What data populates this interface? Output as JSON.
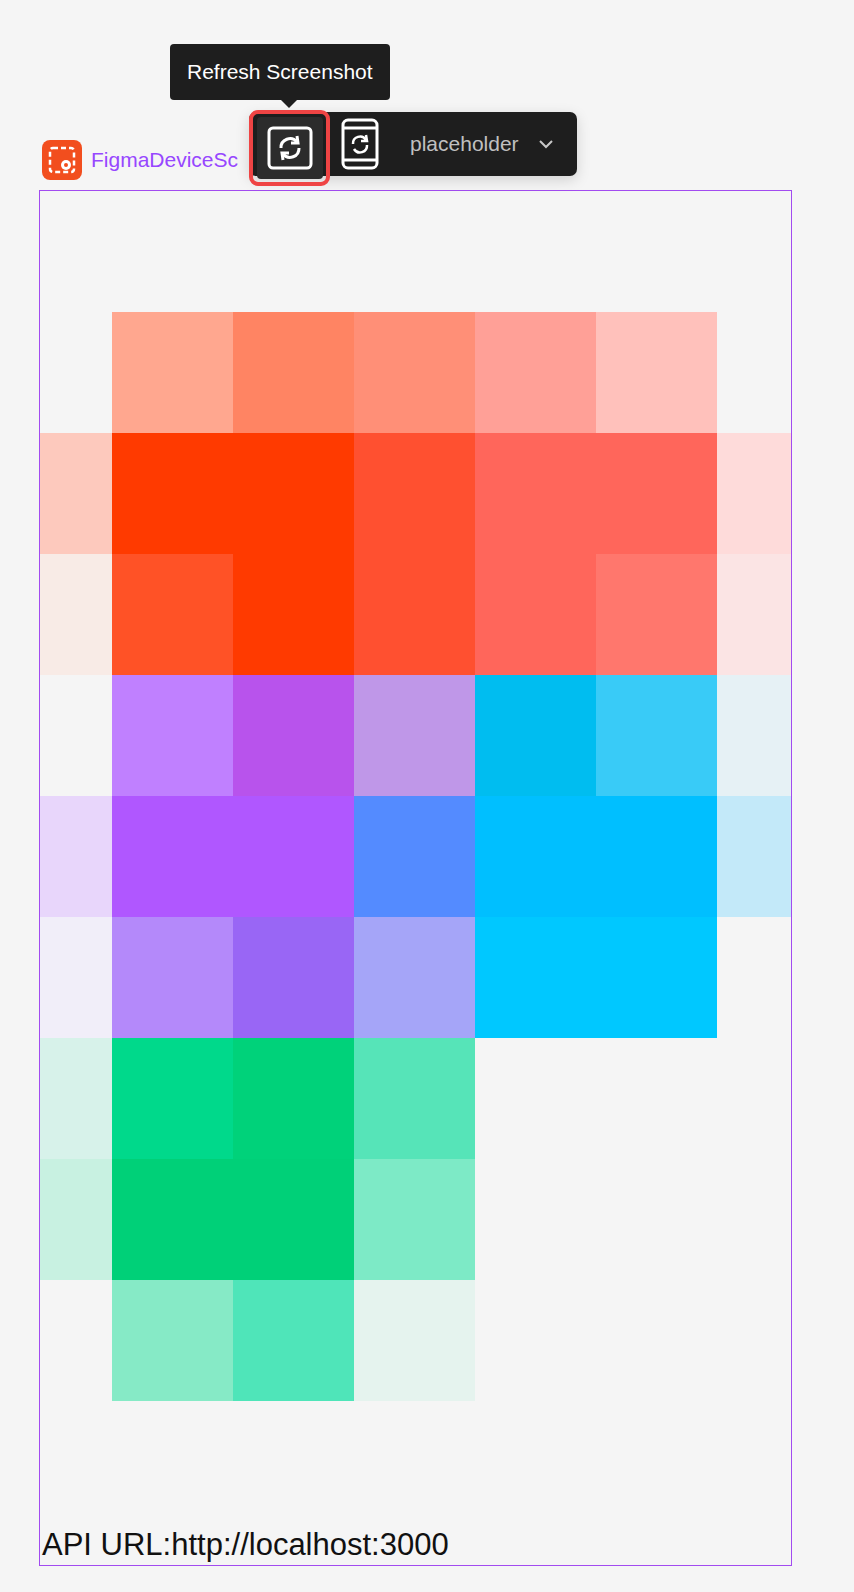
{
  "tooltip": {
    "text": "Refresh Screenshot"
  },
  "toolbar": {
    "buttons": [
      {
        "kind": "refresh",
        "highlighted": true
      },
      {
        "kind": "device",
        "highlighted": false
      }
    ],
    "dropdown": {
      "value": "placeholder"
    }
  },
  "frame": {
    "label": "FigmaDeviceSc",
    "pixels": [
      [
        null,
        "#ffa78f",
        "#ff8463",
        "#ff8f77",
        "#ffa097",
        "#ffc1bb",
        null
      ],
      [
        "#fdc9bd",
        "#ff3a00",
        "#ff3a00",
        "#ff5030",
        "#ff665b",
        "#ff665b",
        "#fedbda"
      ],
      [
        "#f8ebe6",
        "#ff5226",
        "#ff3a00",
        "#ff5030",
        "#ff665b",
        "#ff776d",
        "#fbe4e4"
      ],
      [
        null,
        "#c080ff",
        "#b853ec",
        "#bf97e8",
        "#00bdf0",
        "#39cbf7",
        "#e6f1f5"
      ],
      [
        "#e8d6fb",
        "#b057ff",
        "#b057ff",
        "#548bff",
        "#00bfff",
        "#00bfff",
        "#c3e9f9"
      ],
      [
        "#f1eef9",
        "#b489fa",
        "#9966f5",
        "#a5a5f8",
        "#00c8ff",
        "#00c8ff",
        null
      ],
      [
        "#d7f2ea",
        "#00d98b",
        "#00d27a",
        "#56e4b8",
        null,
        null,
        null
      ],
      [
        "#c8f1e1",
        "#00d078",
        "#00d078",
        "#7deac6",
        null,
        null,
        null
      ],
      [
        null,
        "#86eac6",
        "#4fe5b9",
        "#e5f3ee",
        null,
        null,
        null
      ]
    ],
    "footer": "API URL:http://localhost:3000"
  }
}
